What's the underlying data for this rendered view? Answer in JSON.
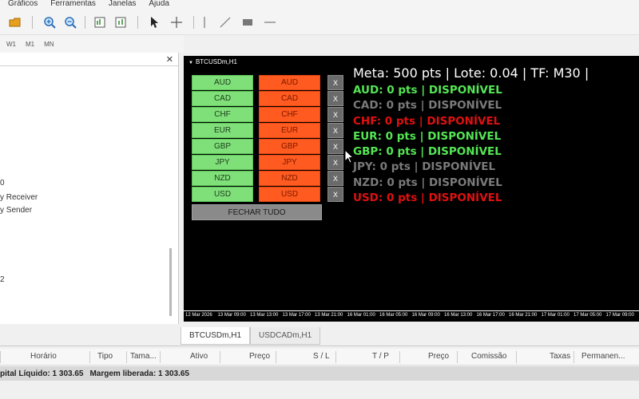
{
  "menu": [
    "Gráficos",
    "Ferramentas",
    "Janelas",
    "Ajuda"
  ],
  "periods": [
    "W1",
    "M1",
    "MN"
  ],
  "navigator": {
    "items": [
      "0",
      "y Receiver",
      "y Sender",
      "2"
    ]
  },
  "chart": {
    "title": "BTCUSDm,H1",
    "currencies": [
      "AUD",
      "CAD",
      "CHF",
      "EUR",
      "GBP",
      "JPY",
      "NZD",
      "USD"
    ],
    "close_button_label": "X",
    "close_all_label": "FECHAR TUDO",
    "header": "Meta: 500 pts  |  Lote: 0.04  |  TF: M30  |  ",
    "status_lines": [
      {
        "text": "AUD: 0 pts | DISPONÍVEL",
        "color": "#55e655"
      },
      {
        "text": "CAD: 0 pts | DISPONÍVEL",
        "color": "#7a7a7a"
      },
      {
        "text": "CHF: 0 pts | DISPONÍVEL",
        "color": "#e01010"
      },
      {
        "text": "EUR: 0 pts | DISPONÍVEL",
        "color": "#55e655"
      },
      {
        "text": "GBP: 0 pts | DISPONÍVEL",
        "color": "#55e655"
      },
      {
        "text": "JPY: 0 pts | DISPONÍVEL",
        "color": "#7a7a7a"
      },
      {
        "text": "NZD: 0 pts | DISPONÍVEL",
        "color": "#7a7a7a"
      },
      {
        "text": "USD: 0 pts | DISPONÍVEL",
        "color": "#e01010"
      }
    ],
    "time_labels": [
      "12 Mar 2026",
      "13 Mar 09:00",
      "13 Mar 13:00",
      "13 Mar 17:00",
      "13 Mar 21:00",
      "16 Mar 01:00",
      "16 Mar 05:00",
      "16 Mar 09:00",
      "16 Mar 13:00",
      "16 Mar 17:00",
      "16 Mar 21:00",
      "17 Mar 01:00",
      "17 Mar 05:00",
      "17 Mar 09:00"
    ]
  },
  "tabs": [
    "BTCUSDm,H1",
    "USDCADm,H1"
  ],
  "table": {
    "columns": [
      "Horário",
      "Tipo",
      "Tama...",
      "Ativo",
      "Preço",
      "S / L",
      "T / P",
      "Preço",
      "Comissão",
      "Taxas",
      "Permanen..."
    ]
  },
  "summary": {
    "capital": "pital Líquido: 1 303.65",
    "margem": "Margem liberada: 1 303.65"
  }
}
